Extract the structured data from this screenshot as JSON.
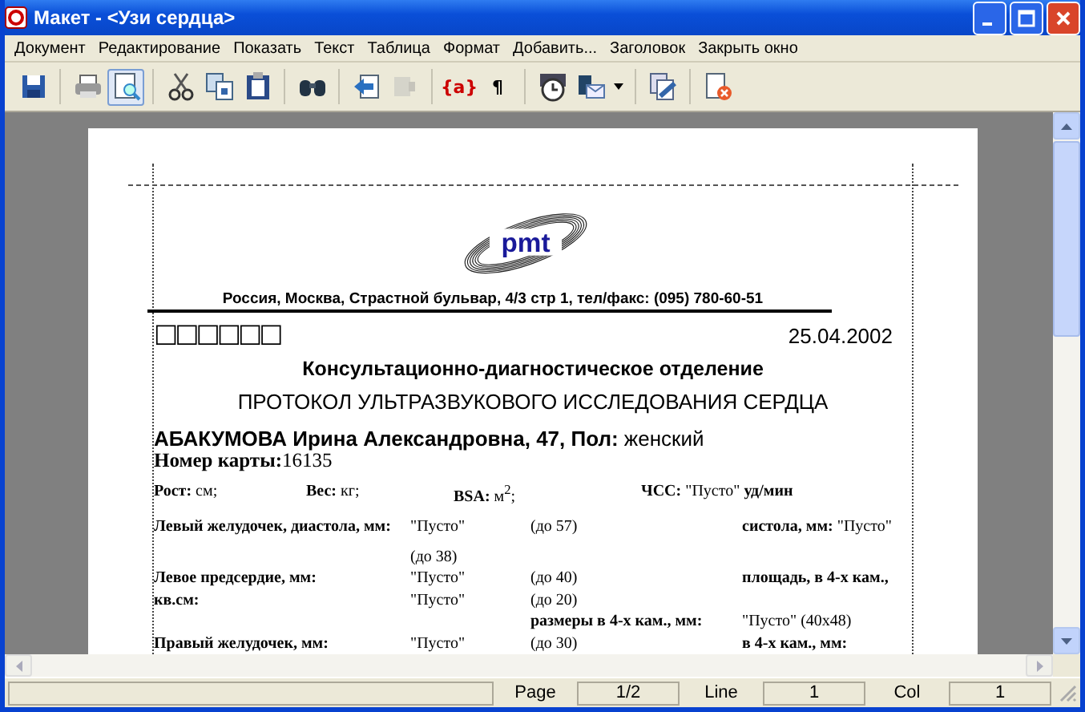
{
  "window": {
    "title": "Макет -  <Узи сердца>"
  },
  "menu": [
    "Документ",
    "Редактирование",
    "Показать",
    "Текст",
    "Таблица",
    "Формат",
    "Добавить...",
    "Заголовок",
    "Закрыть окно"
  ],
  "toolbar": [
    {
      "kind": "icon",
      "pressed": false,
      "disabled": false
    },
    {
      "kind": "separator"
    },
    {
      "kind": "icon",
      "pressed": false,
      "disabled": false
    },
    {
      "kind": "icon",
      "pressed": true,
      "disabled": false
    },
    {
      "kind": "separator"
    },
    {
      "kind": "icon",
      "pressed": false,
      "disabled": false
    },
    {
      "kind": "icon",
      "pressed": false,
      "disabled": false
    },
    {
      "kind": "icon",
      "pressed": false,
      "disabled": false
    },
    {
      "kind": "separator"
    },
    {
      "kind": "icon",
      "pressed": false,
      "disabled": false
    },
    {
      "kind": "separator"
    },
    {
      "kind": "icon",
      "pressed": false,
      "disabled": false
    },
    {
      "kind": "icon",
      "pressed": false,
      "disabled": true
    },
    {
      "kind": "separator"
    },
    {
      "kind": "glyph",
      "text": "{a}",
      "pressed": false,
      "disabled": false
    },
    {
      "kind": "glyph",
      "text": "¶",
      "pressed": false,
      "disabled": false
    },
    {
      "kind": "separator"
    },
    {
      "kind": "icon",
      "pressed": false,
      "disabled": false
    },
    {
      "kind": "icon",
      "pressed": false,
      "disabled": false
    },
    {
      "kind": "separator"
    },
    {
      "kind": "icon",
      "pressed": false,
      "disabled": false
    },
    {
      "kind": "separator"
    },
    {
      "kind": "icon",
      "pressed": false,
      "disabled": false
    }
  ],
  "document": {
    "logo": {
      "text": "pmt"
    },
    "address": "Россия, Москва,  Страстной бульвар, 4/3 стр 1, тел/факс: (095) 780-60-51",
    "boxes": "□□□□□□",
    "date": "25.04.2002",
    "department": "Консультационно-диагностическое отделение",
    "protocol_title": "ПРОТОКОЛ УЛЬТРАЗВУКОВОГО ИССЛЕДОВАНИЯ СЕРДЦА",
    "patient": "**АБАКУМОВА Ирина Александровна, 47, Пол:** женский",
    "card": "**Номер карты:**16135",
    "vitals": [
      "**Рост:**  см;",
      "**Вес:**  кг;",
      "**BSA:**  м$^{2}$;",
      "**ЧСС:** \"Пусто\" **уд/мин**"
    ],
    "rows": [
      [
        "**Левый желудочек, диастола, мм:**",
        "\"Пусто\"",
        "(до 57)",
        "**систола, мм:**   \"Пусто\""
      ],
      [
        "",
        "(до 38)",
        "",
        ""
      ],
      [
        "**Левое предсердие, мм:**",
        "\"Пусто\"",
        "(до 40)",
        "**площадь, в 4-х кам.,**"
      ],
      [
        "**кв.см:**",
        "\"Пусто\"",
        "(до 20)",
        ""
      ],
      [
        "",
        "",
        "**размеры в 4-х кам., мм:**",
        "\"Пусто\"  (40x48)"
      ],
      [
        "**Правый желудочек, мм:**",
        "\"Пусто\"",
        "(до 30)",
        "**в 4-х кам., мм:**"
      ]
    ]
  },
  "status_bar": [
    {
      "label": "Page",
      "value": "1/2"
    },
    {
      "label": "Line",
      "value": "1"
    },
    {
      "label": "Col",
      "value": "1"
    }
  ]
}
